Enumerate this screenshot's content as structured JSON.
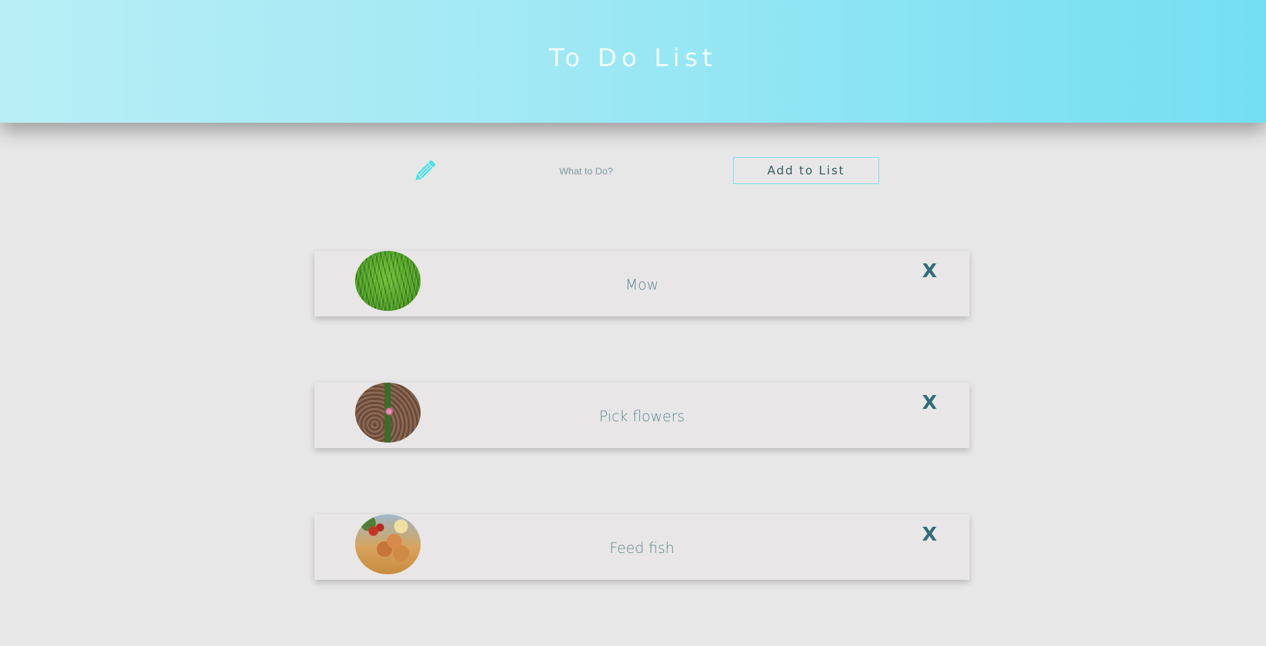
{
  "header": {
    "title": "To Do List"
  },
  "entry": {
    "icon": "pencil-icon",
    "placeholder": "What to Do?",
    "add_label": "Add to List"
  },
  "list": {
    "items": [
      {
        "label": "Mow",
        "image": "grass-image",
        "delete_label": "X"
      },
      {
        "label": "Pick flowers",
        "image": "flower-image",
        "delete_label": "X"
      },
      {
        "label": "Feed fish",
        "image": "food-image",
        "delete_label": "X"
      }
    ]
  },
  "colors": {
    "header_gradient_start": "#b8eef6",
    "header_gradient_end": "#74dff2",
    "page_background": "#e8e7e7",
    "accent": "#4ee3e9",
    "item_text": "#5b8a8f",
    "delete_x": "#2e6d7a"
  }
}
